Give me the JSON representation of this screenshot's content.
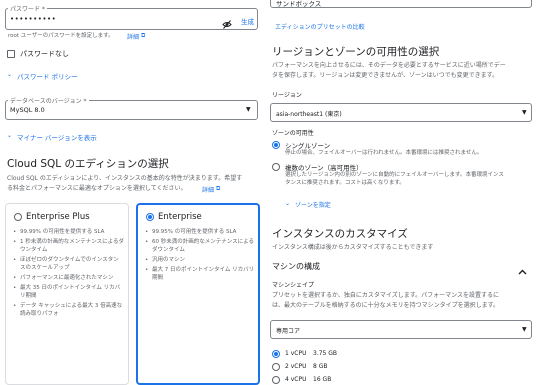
{
  "left": {
    "password_field": {
      "label": "パスワード *",
      "value": "••••••••••",
      "generate_label": "生成"
    },
    "root_password_note": "root ユーザーのパスワードを設定します。",
    "details_link": "詳細",
    "no_password_label": "パスワードなし",
    "password_policy_link": "パスワード ポリシー",
    "version_field": {
      "label": "データベースのバージョン *",
      "value": "MySQL 8.0"
    },
    "minor_versions_link": "マイナー バージョンを表示",
    "edition_heading": "Cloud SQL のエディションの選択",
    "edition_desc_1": "Cloud SQL のエディションにより、インスタンスの基本的な特性が決まります。希望す",
    "edition_desc_2": "る料金とパフォーマンスに最適なオプションを選択してください。",
    "edition_details_link": "詳細",
    "plus_card": {
      "title": "Enterprise Plus",
      "bullets": [
        "99.99% の可用性を提供する SLA",
        "1 秒未満の計画的なメンテナンスによるダウンタイム",
        "ほぼゼロのダウンタイムでのインスタンスのスケールアップ",
        "パフォーマンスに最適化されたマシン",
        "最大 35 日のポイントインタイム リカバリ期間",
        "データ キャッシュによる最大 3 倍高速な読み取りパフォ"
      ]
    },
    "ent_card": {
      "title": "Enterprise",
      "bullets": [
        "99.95% の可用性を提供する SLA",
        "60 秒未満の計画的なメンテナンスによるダウンタイム",
        "汎用のマシン",
        "最大 7 日のポイントインタイム リカバリ期間"
      ]
    }
  },
  "right": {
    "sandbox_text": "サンドボックス",
    "preset_compare_link": "エディションのプリセットの比較",
    "region_heading": "リージョンとゾーンの可用性の選択",
    "region_desc_1": "パフォーマンスを向上させるには、そのデータを必要とするサービスに近い場所でデー",
    "region_desc_2": "タを保存します。リージョンは変更できませんが、ゾーンはいつでも変更できます。",
    "region_label": "リージョン",
    "region_value": "asia-northeast1 (東京)",
    "zone_availability_label": "ゾーンの可用性",
    "single_zone": {
      "title": "シングルゾーン",
      "desc": "停止の場合、フェイルオーバーは行われません。本番環境には推奨されません。"
    },
    "multi_zone": {
      "title": "複数のゾーン（高可用性）",
      "desc_1": "選択したリージョン内の別のゾーンに自動的にフェイルオーバーします。本番環境インス",
      "desc_2": "タンスに推奨されます。コストは高くなります。"
    },
    "zone_specify_link": "ゾーンを指定",
    "custom_heading": "インスタンスのカスタマイズ",
    "custom_desc": "インスタンス構成は後からカスタマイズすることもできます",
    "machine_config_label": "マシンの構成",
    "machine_shape_label": "マシンシェイプ",
    "machine_desc_1": "プリセットを選択するか、独自にカスタマイズします。パフォーマンスを設置するに",
    "machine_desc_2": "は、最大のテーブルを格納するのに十分なメモリを持つマシンタイプを選択します。",
    "machine_type_value": "専用コア",
    "options": [
      {
        "vcpu": "1 vCPU",
        "mem": "3.75 GB"
      },
      {
        "vcpu": "2 vCPU",
        "mem": "8 GB"
      },
      {
        "vcpu": "4 vCPU",
        "mem": "16 GB"
      }
    ]
  }
}
